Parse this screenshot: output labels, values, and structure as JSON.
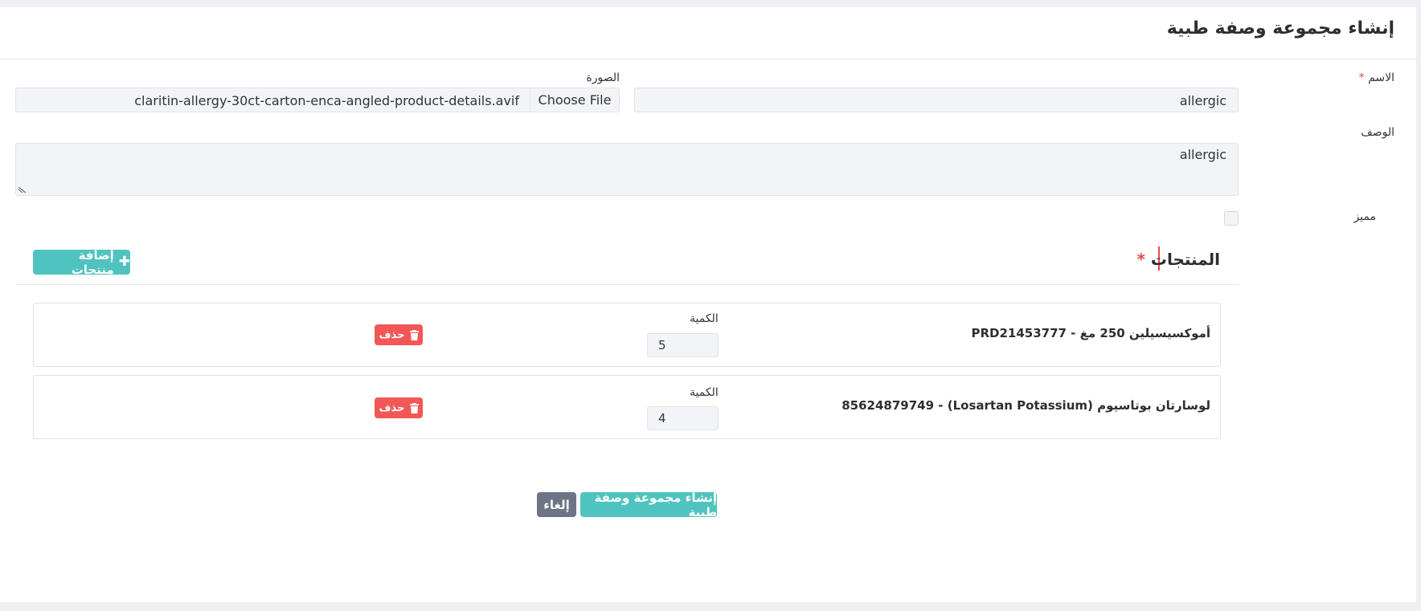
{
  "page": {
    "title": "إنشاء مجموعة وصفة طبية"
  },
  "form": {
    "name": {
      "label": "الاسم",
      "required_mark": "*",
      "value": "allergic"
    },
    "image": {
      "label": "الصورة",
      "button_label": "Choose File",
      "file_name": "claritin-allergy-30ct-carton-enca-angled-product-details.avif"
    },
    "description": {
      "label": "الوصف",
      "value": "allergic"
    },
    "featured": {
      "label": "مميز",
      "checked": false
    }
  },
  "products_section": {
    "title": "المنتجات",
    "required_mark": "*",
    "add_button_label": "إضافة منتجات",
    "add_button_icon": "plus-icon",
    "items": [
      {
        "name": "أموكسيسيلين 250 مغ - PRD21453777",
        "qty_label": "الكمية",
        "qty": "5",
        "delete_label": "حذف",
        "delete_icon": "trash-icon"
      },
      {
        "name": "لوسارتان بوتاسيوم (Losartan Potassium) - 85624879749",
        "qty_label": "الكمية",
        "qty": "4",
        "delete_label": "حذف",
        "delete_icon": "trash-icon"
      }
    ]
  },
  "actions": {
    "submit_label": "إنشاء مجموعة وصفة طبية",
    "cancel_label": "إلغاء"
  },
  "colors": {
    "accent": "#4fc3bf",
    "danger": "#f25757",
    "secondary": "#6c7485",
    "required": "#e84a4a"
  }
}
